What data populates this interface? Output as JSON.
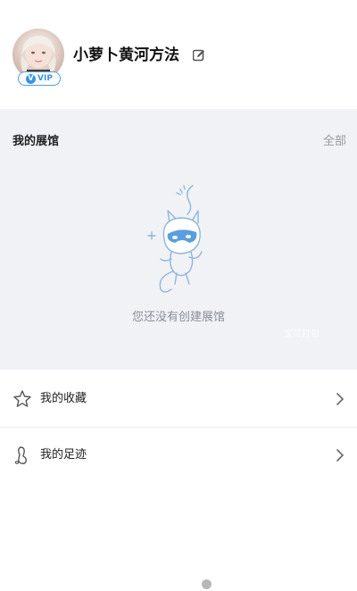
{
  "profile": {
    "username": "小萝卜黄河方法",
    "vip_label": "VIP",
    "vip_v": "V"
  },
  "gallery": {
    "title": "我的展馆",
    "all_label": "全部",
    "empty_text": "您还没有创建展馆",
    "watermark": "宝贝打包"
  },
  "menu": [
    {
      "label": "我的收藏",
      "icon": "star-icon"
    },
    {
      "label": "我的足迹",
      "icon": "footprint-icon"
    }
  ],
  "colors": {
    "accent": "#3b95df",
    "gallery_bg": "#f0f2f6",
    "muted_text": "#8a8f99"
  }
}
